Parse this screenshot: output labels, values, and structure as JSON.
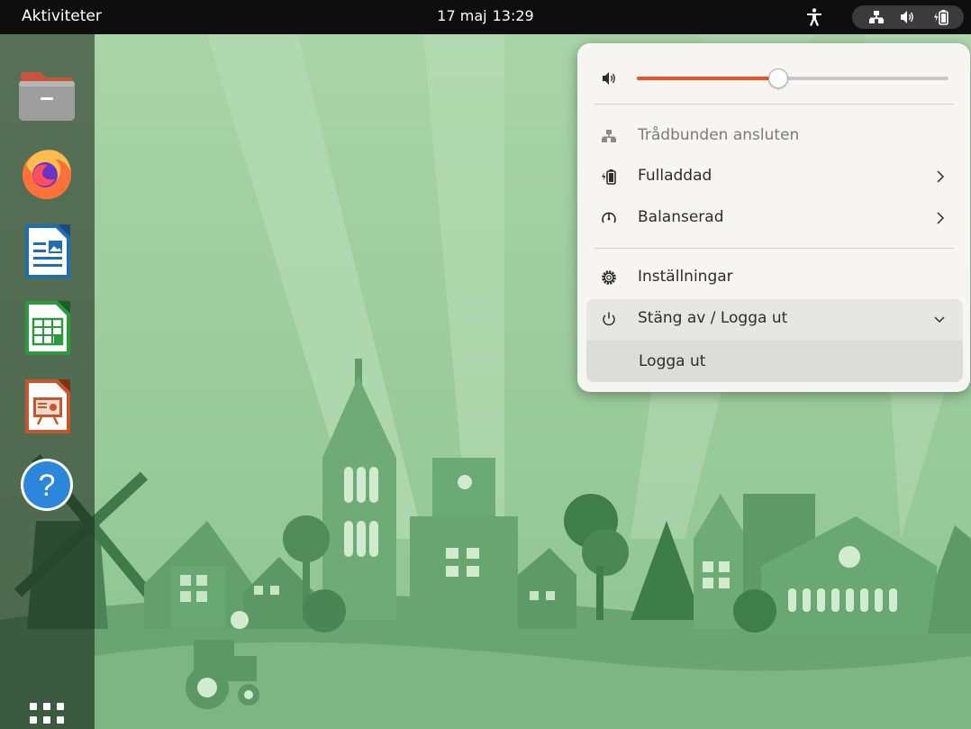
{
  "topbar": {
    "activities_label": "Aktiviteter",
    "date": "17 maj",
    "time": "13:29",
    "indicators": [
      "accessibility-icon",
      "network-wired-icon",
      "volume-icon",
      "battery-charging-icon"
    ]
  },
  "dock": {
    "items": [
      {
        "name": "files-icon"
      },
      {
        "name": "firefox-icon"
      },
      {
        "name": "libreoffice-writer-icon"
      },
      {
        "name": "libreoffice-calc-icon"
      },
      {
        "name": "libreoffice-impress-icon"
      },
      {
        "name": "help-icon",
        "glyph": "?"
      }
    ],
    "show_apps_icon": "grid-icon"
  },
  "system_menu": {
    "volume": {
      "icon": "volume-icon",
      "level": 0.45
    },
    "network": {
      "icon": "network-wired-icon",
      "label": "Trådbunden ansluten"
    },
    "battery": {
      "icon": "battery-charging-icon",
      "label": "Fulladdad"
    },
    "power_mode": {
      "icon": "power-profile-icon",
      "label": "Balanserad"
    },
    "settings": {
      "icon": "gear-icon",
      "label": "Inställningar"
    },
    "power_off": {
      "icon": "power-icon",
      "label": "Stäng av / Logga ut",
      "expanded": true
    },
    "submenu": [
      {
        "label": "Logga ut"
      }
    ]
  },
  "colors": {
    "accent": "#e95420",
    "topbar_bg": "#0e0e0e",
    "menu_bg": "#f6f5f4",
    "wallpaper_light": "#b7dcb5",
    "wallpaper_dark": "#5e9a68"
  }
}
